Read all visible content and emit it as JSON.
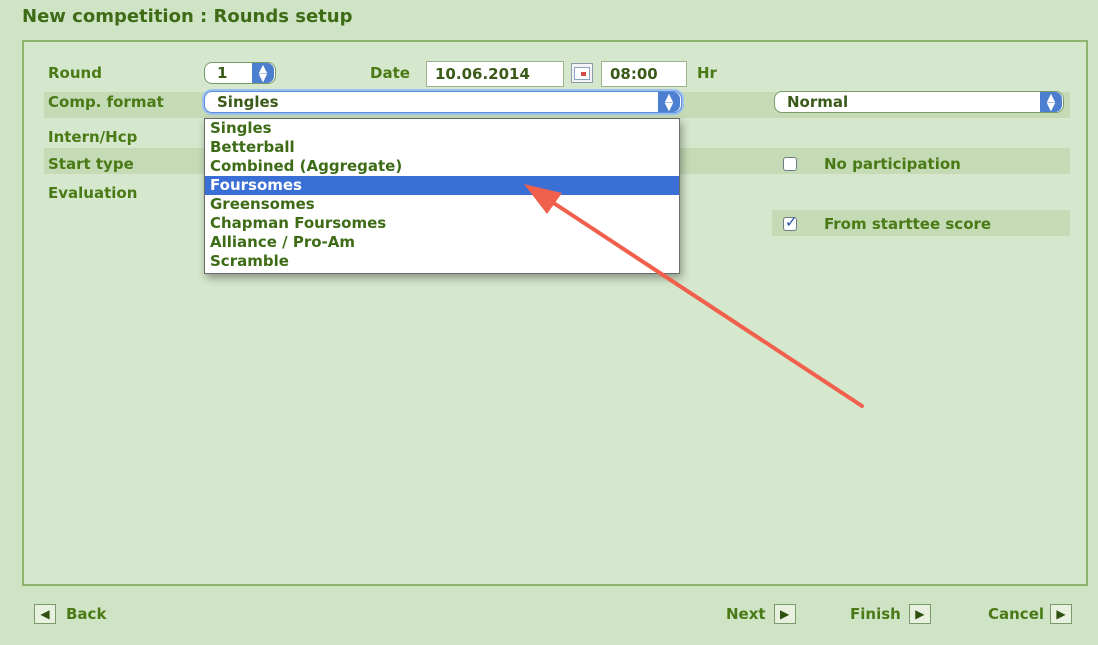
{
  "title": "New competition : Rounds setup",
  "fields": {
    "round_label": "Round",
    "round_value": "1",
    "date_label": "Date",
    "date_value": "10.06.2014",
    "time_value": "08:00",
    "hr_label": "Hr",
    "comp_format_label": "Comp. format",
    "comp_format_value": "Singles",
    "mode_value": "Normal",
    "intern_label": "Intern/Hcp",
    "start_type_label": "Start type",
    "evaluation_label": "Evaluation",
    "no_participation_label": "No participation",
    "no_participation_checked": false,
    "from_starttee_label": "From starttee score",
    "from_starttee_checked": true
  },
  "dropdown": {
    "options": [
      "Singles",
      "Betterball",
      "Combined (Aggregate)",
      "Foursomes",
      "Greensomes",
      "Chapman Foursomes",
      "Alliance / Pro-Am",
      "Scramble"
    ],
    "highlighted": "Foursomes"
  },
  "nav": {
    "back": "Back",
    "next": "Next",
    "finish": "Finish",
    "cancel": "Cancel"
  },
  "colors": {
    "background": "#cfe3c5",
    "text": "#4a7a16",
    "highlight": "#3a6fd6",
    "arrow": "#f0604c"
  },
  "icons": {
    "spinner": "up-down-arrows-icon",
    "calendar": "calendar-icon",
    "back": "triangle-left-icon",
    "forward": "triangle-right-icon"
  }
}
